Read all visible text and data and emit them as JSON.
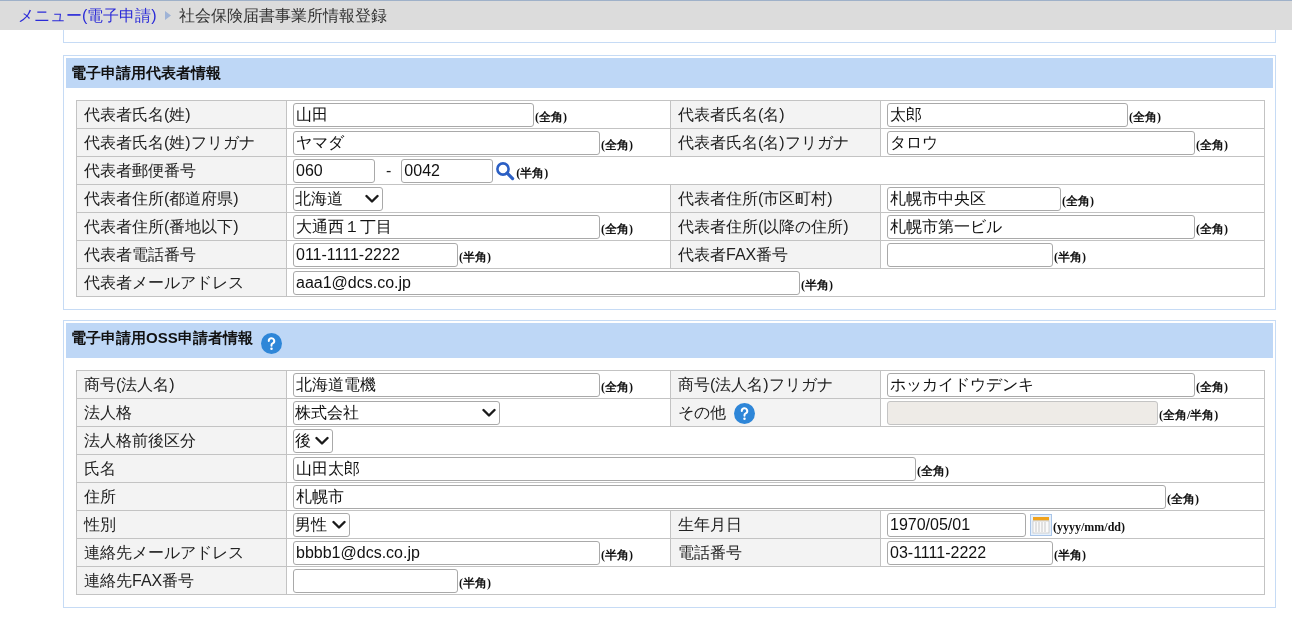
{
  "breadcrumb": {
    "link": "メニュー(電子申請)",
    "current": "社会保険届書事業所情報登録"
  },
  "sections": [
    {
      "title": "電子申請用代表者情報",
      "help": false,
      "rows": [
        {
          "cells": [
            {
              "label": "代表者氏名(姓)",
              "help": false,
              "field": {
                "kind": "text",
                "value": "山田",
                "disabled": false,
                "hint": "(全角)"
              }
            },
            {
              "label": "代表者氏名(名)",
              "help": false,
              "field": {
                "kind": "text",
                "value": "太郎",
                "disabled": false,
                "hint": "(全角)"
              }
            }
          ]
        },
        {
          "cells": [
            {
              "label": "代表者氏名(姓)フリガナ",
              "help": false,
              "field": {
                "kind": "text",
                "value": "ヤマダ",
                "disabled": false,
                "hint": "(全角)"
              }
            },
            {
              "label": "代表者氏名(名)フリガナ",
              "help": false,
              "field": {
                "kind": "text",
                "value": "タロウ",
                "disabled": false,
                "hint": "(全角)"
              }
            }
          ]
        },
        {
          "cells": [
            {
              "label": "代表者郵便番号",
              "help": false,
              "field": {
                "kind": "postal",
                "values": [
                  "060",
                  "0042"
                ],
                "separator": "-",
                "disabled": false,
                "hint": "(半角)"
              }
            }
          ]
        },
        {
          "cells": [
            {
              "label": "代表者住所(都道府県)",
              "help": false,
              "field": {
                "kind": "select",
                "value": "北海道",
                "disabled": false
              }
            },
            {
              "label": "代表者住所(市区町村)",
              "help": false,
              "field": {
                "kind": "text",
                "value": "札幌市中央区",
                "disabled": false,
                "hint": "(全角)"
              }
            }
          ]
        },
        {
          "cells": [
            {
              "label": "代表者住所(番地以下)",
              "help": false,
              "field": {
                "kind": "text",
                "value": "大通西１丁目",
                "disabled": false,
                "hint": "(全角)"
              }
            },
            {
              "label": "代表者住所(以降の住所)",
              "help": false,
              "field": {
                "kind": "text",
                "value": "札幌市第一ビル",
                "disabled": false,
                "hint": "(全角)"
              }
            }
          ]
        },
        {
          "cells": [
            {
              "label": "代表者電話番号",
              "help": false,
              "field": {
                "kind": "text",
                "value": "011-1111-2222",
                "disabled": false,
                "hint": "(半角)"
              }
            },
            {
              "label": "代表者FAX番号",
              "help": false,
              "field": {
                "kind": "text",
                "disabled": false,
                "hint": "(半角)"
              }
            }
          ]
        },
        {
          "cells": [
            {
              "label": "代表者メールアドレス",
              "help": false,
              "field": {
                "kind": "text",
                "value": "aaa1@dcs.co.jp",
                "disabled": false,
                "hint": "(半角)"
              }
            }
          ]
        }
      ]
    },
    {
      "title": "電子申請用OSS申請者情報",
      "help": true,
      "rows": [
        {
          "cells": [
            {
              "label": "商号(法人名)",
              "help": false,
              "field": {
                "kind": "text",
                "value": "北海道電機",
                "disabled": false,
                "hint": "(全角)"
              }
            },
            {
              "label": "商号(法人名)フリガナ",
              "help": false,
              "field": {
                "kind": "text",
                "value": "ホッカイドウデンキ",
                "disabled": false,
                "hint": "(全角)"
              }
            }
          ]
        },
        {
          "cells": [
            {
              "label": "法人格",
              "help": false,
              "field": {
                "kind": "select",
                "value": "株式会社",
                "disabled": false
              }
            },
            {
              "label": "その他",
              "help": true,
              "field": {
                "kind": "text",
                "disabled": true,
                "hint": "(全角/半角)"
              }
            }
          ]
        },
        {
          "cells": [
            {
              "label": "法人格前後区分",
              "help": false,
              "field": {
                "kind": "select",
                "value": "後",
                "disabled": false
              }
            }
          ]
        },
        {
          "cells": [
            {
              "label": "氏名",
              "help": false,
              "field": {
                "kind": "text",
                "value": "山田太郎",
                "disabled": false,
                "hint": "(全角)"
              }
            }
          ]
        },
        {
          "cells": [
            {
              "label": "住所",
              "help": false,
              "field": {
                "kind": "text",
                "value": "札幌市",
                "disabled": false,
                "hint": "(全角)"
              }
            }
          ]
        },
        {
          "cells": [
            {
              "label": "性別",
              "help": false,
              "field": {
                "kind": "select",
                "value": "男性",
                "disabled": false
              }
            },
            {
              "label": "生年月日",
              "help": false,
              "field": {
                "kind": "date",
                "value": "1970/05/01",
                "disabled": false,
                "hint": "(yyyy/mm/dd)"
              }
            }
          ]
        },
        {
          "cells": [
            {
              "label": "連絡先メールアドレス",
              "help": false,
              "field": {
                "kind": "text",
                "value": "bbbb1@dcs.co.jp",
                "disabled": false,
                "hint": "(半角)"
              }
            },
            {
              "label": "電話番号",
              "help": false,
              "field": {
                "kind": "text",
                "value": "03-1111-2222",
                "disabled": false,
                "hint": "(半角)"
              }
            }
          ]
        },
        {
          "cells": [
            {
              "label": "連絡先FAX番号",
              "help": false,
              "field": {
                "kind": "text",
                "disabled": false,
                "hint": "(半角)"
              }
            }
          ]
        }
      ]
    }
  ]
}
